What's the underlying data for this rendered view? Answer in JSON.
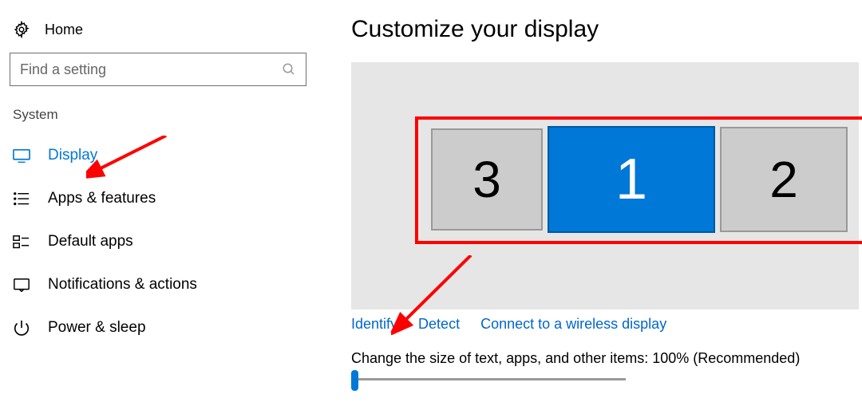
{
  "sidebar": {
    "home_label": "Home",
    "search_placeholder": "Find a setting",
    "section_label": "System",
    "items": [
      {
        "label": "Display",
        "icon": "display-monitor-icon",
        "active": true
      },
      {
        "label": "Apps & features",
        "icon": "apps-list-icon"
      },
      {
        "label": "Default apps",
        "icon": "default-apps-icon"
      },
      {
        "label": "Notifications & actions",
        "icon": "notifications-icon"
      },
      {
        "label": "Power & sleep",
        "icon": "power-icon"
      }
    ]
  },
  "main": {
    "title": "Customize your display",
    "monitors": [
      {
        "id": "3",
        "selected": false
      },
      {
        "id": "1",
        "selected": true
      },
      {
        "id": "2",
        "selected": false
      }
    ],
    "links": {
      "identify": "Identify",
      "detect": "Detect",
      "connect": "Connect to a wireless display"
    },
    "scale_label": "Change the size of text, apps, and other items: 100% (Recommended)"
  },
  "annotations": {
    "highlight_box": true,
    "arrow_to_display": true,
    "arrow_to_identify": true
  }
}
